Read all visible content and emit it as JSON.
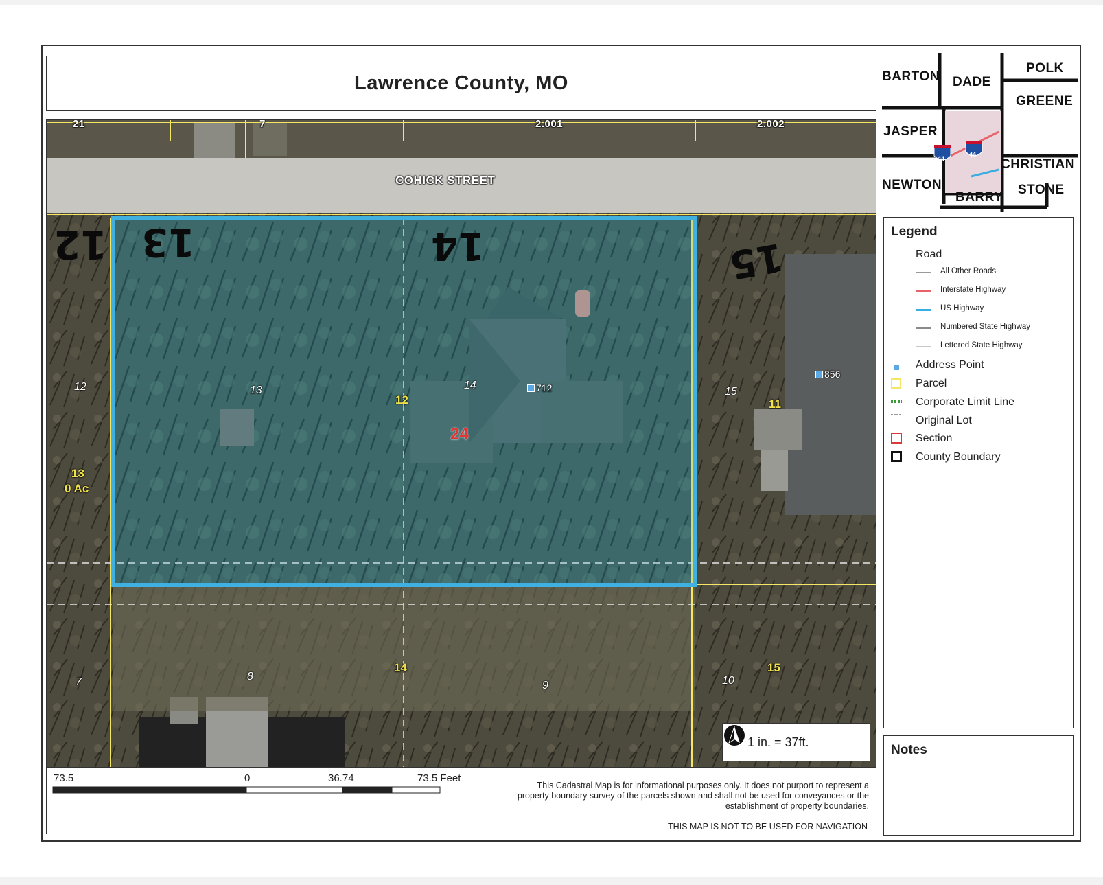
{
  "title": "Lawrence County, MO",
  "map": {
    "road_name": "COHICK STREET",
    "road_numbers": [
      "21",
      "7",
      "2.001",
      "2.002"
    ],
    "handwritten_lots": [
      "12",
      "13",
      "14",
      "15"
    ],
    "parcel_labels_yellow": [
      "12",
      "24",
      "11",
      "13",
      "0 Ac",
      "14",
      "15"
    ],
    "lot_labels": [
      "12",
      "13",
      "14",
      "15",
      "7",
      "8",
      "9",
      "10"
    ],
    "address_points": [
      "712",
      "856"
    ],
    "scale_text": "1 in. = 37ft.",
    "north_icon": "north-arrow-icon"
  },
  "scale_bar": {
    "left": "73.5",
    "zero": "0",
    "mid": "36.74",
    "right": "73.5 Feet"
  },
  "disclaimer": "This Cadastral Map is for informational purposes only.  It does not purport to represent a property boundary survey of the parcels shown and shall not be used for conveyances or the establishment of property boundaries.",
  "nav_note": "THIS MAP IS NOT TO BE USED FOR NAVIGATION",
  "locator": {
    "counties": [
      "BARTON",
      "DADE",
      "POLK",
      "GREENE",
      "JASPER",
      "CHRISTIAN",
      "NEWTON",
      "BARRY",
      "STONE"
    ],
    "highway_shield": "44"
  },
  "legend": {
    "title": "Legend",
    "road_heading": "Road",
    "road_types": [
      {
        "label": "All Other Roads",
        "color": "#9a9a9a"
      },
      {
        "label": "Interstate Highway",
        "color": "#e8626a"
      },
      {
        "label": "US Highway",
        "color": "#3aaee0"
      },
      {
        "label": "Numbered State Highway",
        "color": "#8a8a8a"
      },
      {
        "label": "Lettered State Highway",
        "color": "#c8c8c8"
      }
    ],
    "items": [
      {
        "label": "Address Point",
        "color": "#5aa9e6"
      },
      {
        "label": "Parcel",
        "color": "#f5e663"
      },
      {
        "label": "Corporate Limit Line",
        "color": "#3a9a3a"
      },
      {
        "label": "Original Lot",
        "color": "#999999"
      },
      {
        "label": "Section",
        "color": "#d93a3a"
      },
      {
        "label": "County Boundary",
        "color": "#111111"
      }
    ]
  },
  "notes": {
    "title": "Notes"
  },
  "colors": {
    "highlight": "#3fb0e0",
    "parcel_line": "#f5e663"
  }
}
